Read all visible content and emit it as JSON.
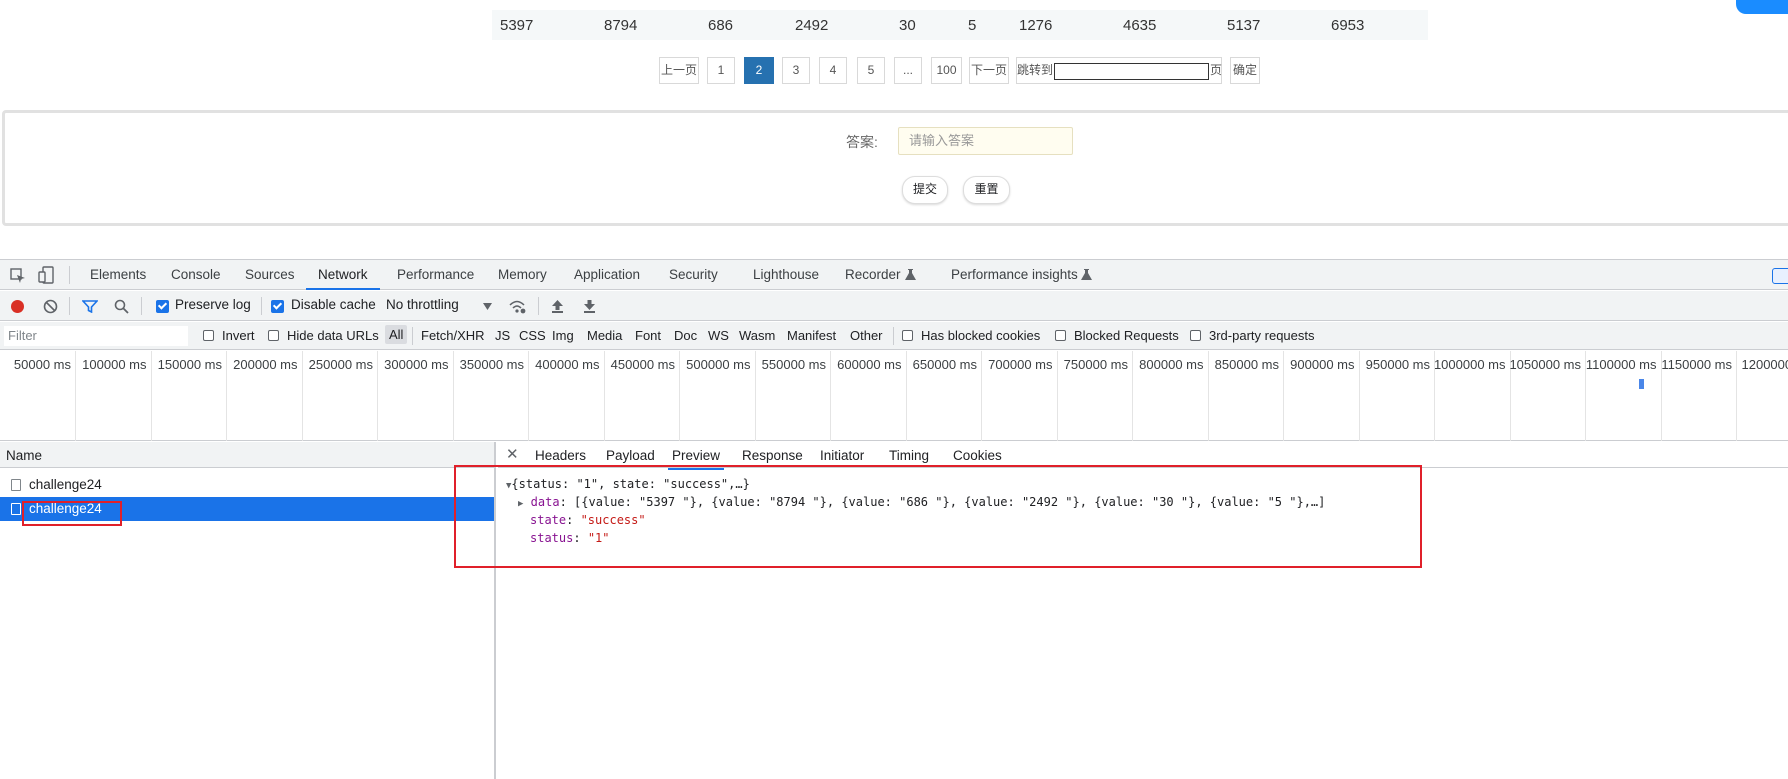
{
  "table": {
    "values": [
      "5397",
      "8794",
      "686",
      "2492",
      "30",
      "5",
      "1276",
      "4635",
      "5137",
      "6953"
    ]
  },
  "pagination": {
    "prev": "上一页",
    "pages": [
      "1",
      "2",
      "3",
      "4",
      "5",
      "...",
      "100"
    ],
    "current": "2",
    "next": "下一页",
    "jump_label": "跳转到",
    "jump_suffix": "页",
    "confirm": "确定"
  },
  "answer": {
    "label": "答案:",
    "placeholder": "请输入答案",
    "submit": "提交",
    "reset": "重置"
  },
  "devtools": {
    "tabs": [
      "Elements",
      "Console",
      "Sources",
      "Network",
      "Performance",
      "Memory",
      "Application",
      "Security",
      "Lighthouse",
      "Recorder",
      "Performance insights"
    ],
    "active_tab": "Network",
    "toolbar": {
      "preserve_log": "Preserve log",
      "disable_cache": "Disable cache",
      "throttling": "No throttling"
    },
    "filter": {
      "placeholder": "Filter",
      "invert": "Invert",
      "hide_data_urls": "Hide data URLs",
      "types": [
        "All",
        "Fetch/XHR",
        "JS",
        "CSS",
        "Img",
        "Media",
        "Font",
        "Doc",
        "WS",
        "Wasm",
        "Manifest",
        "Other"
      ],
      "has_blocked_cookies": "Has blocked cookies",
      "blocked_requests": "Blocked Requests",
      "third_party": "3rd-party requests"
    },
    "timeline_labels": [
      "50000 ms",
      "100000 ms",
      "150000 ms",
      "200000 ms",
      "250000 ms",
      "300000 ms",
      "350000 ms",
      "400000 ms",
      "450000 ms",
      "500000 ms",
      "550000 ms",
      "600000 ms",
      "650000 ms",
      "700000 ms",
      "750000 ms",
      "800000 ms",
      "850000 ms",
      "900000 ms",
      "950000 ms",
      "1000000 ms",
      "1050000 ms",
      "1100000 ms",
      "1150000 ms",
      "1200000"
    ],
    "requests": {
      "header": "Name",
      "rows": [
        "challenge24",
        "challenge24"
      ]
    },
    "detail_tabs": [
      "Headers",
      "Payload",
      "Preview",
      "Response",
      "Initiator",
      "Timing",
      "Cookies"
    ],
    "active_detail_tab": "Preview",
    "preview": {
      "summary": "{status: \"1\", state: \"success\",…}",
      "data_key": "data",
      "data_value": "[{value: \"5397 \"}, {value: \"8794 \"}, {value: \"686 \"}, {value: \"2492 \"}, {value: \"30 \"}, {value: \"5 \"},…]",
      "state_key": "state",
      "state_value": "\"success\"",
      "status_key": "status",
      "status_value": "\"1\""
    }
  }
}
